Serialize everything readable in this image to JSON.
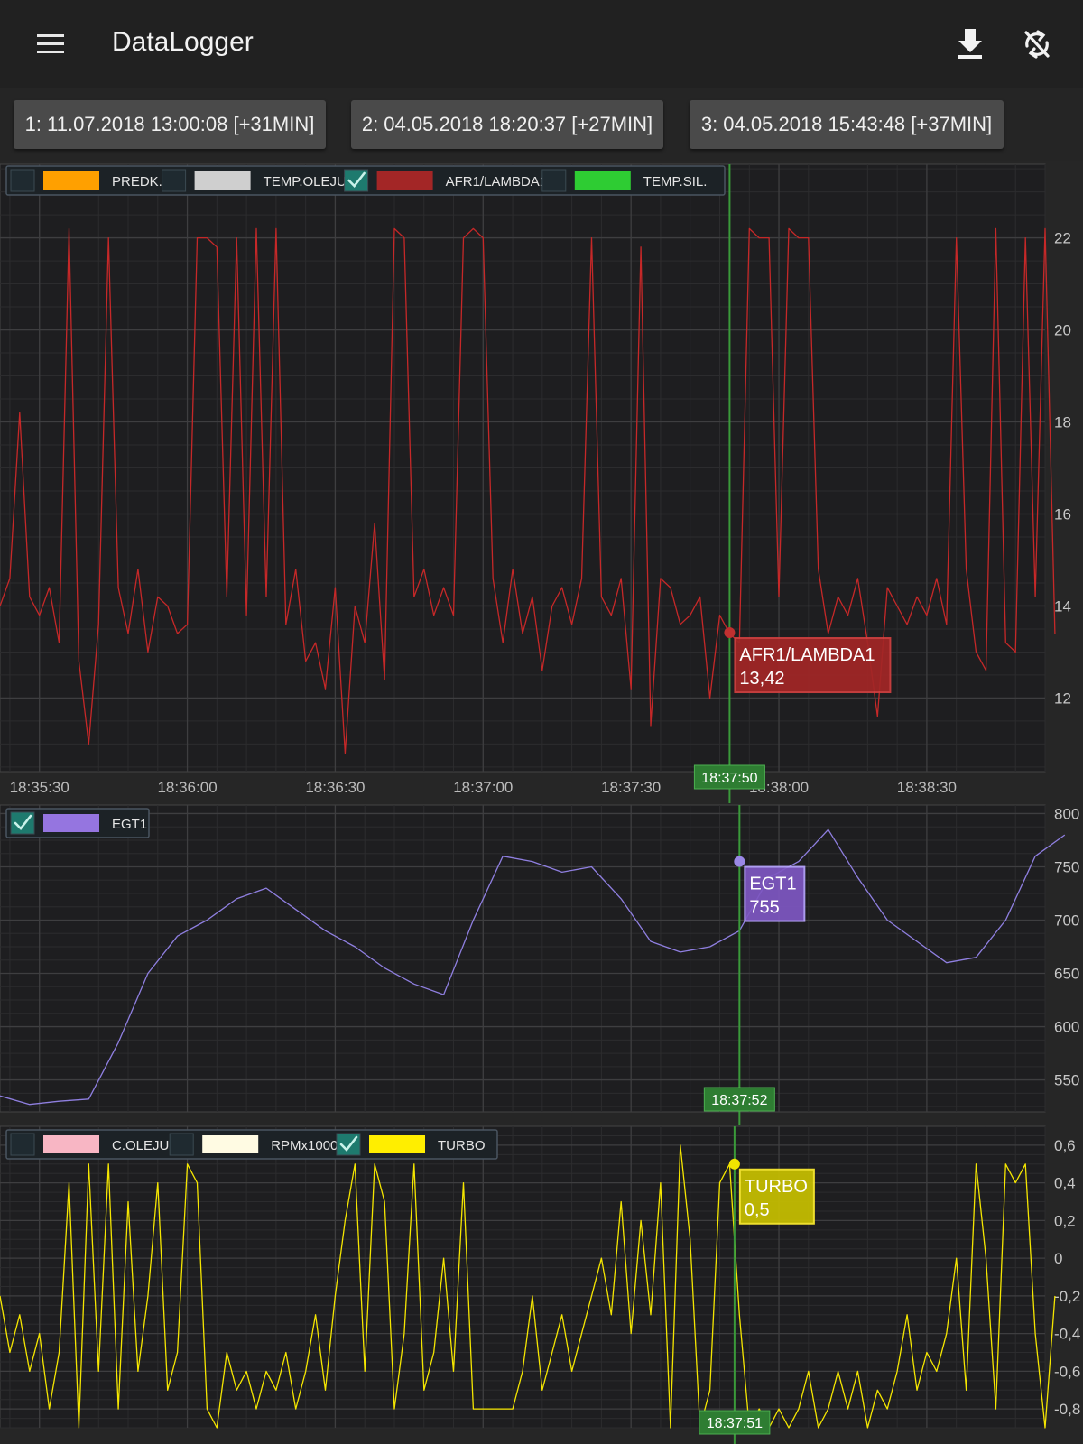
{
  "app": {
    "title": "DataLogger",
    "icons": [
      "menu-icon",
      "download-icon",
      "sync-disabled-icon"
    ]
  },
  "sessions": [
    {
      "label": "1: 11.07.2018 13:00:08 [+31MIN]"
    },
    {
      "label": "2: 04.05.2018 18:20:37 [+27MIN]"
    },
    {
      "label": "3: 04.05.2018 15:43:48 [+37MIN]"
    }
  ],
  "colors": {
    "grid": "#3a3a3a",
    "cursor": "#3a9a3a",
    "cursor_label": "#2e7d32"
  },
  "chart_data": [
    {
      "type": "line",
      "x": [
        "18:35:22",
        "18:35:24",
        "18:35:26",
        "18:35:28",
        "18:35:30",
        "18:35:32",
        "18:35:34",
        "18:35:36",
        "18:35:38",
        "18:35:40",
        "18:35:42",
        "18:35:44",
        "18:35:46",
        "18:35:48",
        "18:35:50",
        "18:35:52",
        "18:35:54",
        "18:35:56",
        "18:35:58",
        "18:36:00",
        "18:36:02",
        "18:36:04",
        "18:36:06",
        "18:36:08",
        "18:36:10",
        "18:36:12",
        "18:36:14",
        "18:36:16",
        "18:36:18",
        "18:36:20",
        "18:36:22",
        "18:36:24",
        "18:36:26",
        "18:36:28",
        "18:36:30",
        "18:36:32",
        "18:36:34",
        "18:36:36",
        "18:36:38",
        "18:36:40",
        "18:36:42",
        "18:36:44",
        "18:36:46",
        "18:36:48",
        "18:36:50",
        "18:36:52",
        "18:36:54",
        "18:36:56",
        "18:36:58",
        "18:37:00",
        "18:37:02",
        "18:37:04",
        "18:37:06",
        "18:37:08",
        "18:37:10",
        "18:37:12",
        "18:37:14",
        "18:37:16",
        "18:37:18",
        "18:37:20",
        "18:37:22",
        "18:37:24",
        "18:37:26",
        "18:37:28",
        "18:37:30",
        "18:37:32",
        "18:37:34",
        "18:37:36",
        "18:37:38",
        "18:37:40",
        "18:37:42",
        "18:37:44",
        "18:37:46",
        "18:37:48",
        "18:37:50",
        "18:37:52",
        "18:37:54",
        "18:37:56",
        "18:37:58",
        "18:38:00",
        "18:38:02",
        "18:38:04",
        "18:38:06",
        "18:38:08",
        "18:38:10",
        "18:38:12",
        "18:38:14",
        "18:38:16",
        "18:38:18",
        "18:38:20",
        "18:38:22",
        "18:38:24",
        "18:38:26",
        "18:38:28",
        "18:38:30",
        "18:38:32",
        "18:38:34",
        "18:38:36",
        "18:38:38",
        "18:38:40",
        "18:38:42",
        "18:38:44",
        "18:38:46",
        "18:38:48",
        "18:38:50",
        "18:38:52",
        "18:38:54",
        "18:38:56"
      ],
      "series": [
        {
          "name": "AFR1/LAMBDA1",
          "color": "#c62828",
          "values": [
            14.0,
            14.6,
            18.2,
            14.2,
            13.8,
            14.4,
            13.2,
            22.2,
            12.8,
            11.0,
            13.6,
            22.0,
            14.4,
            13.4,
            14.8,
            13.0,
            14.2,
            14.0,
            13.4,
            13.6,
            22.0,
            22.0,
            21.8,
            14.2,
            22.0,
            13.8,
            22.2,
            14.2,
            22.2,
            13.6,
            14.8,
            12.8,
            13.2,
            12.2,
            14.4,
            10.8,
            14.0,
            13.2,
            15.8,
            12.4,
            22.2,
            22.0,
            14.2,
            14.8,
            13.8,
            14.4,
            13.8,
            22.0,
            22.2,
            22.0,
            14.6,
            13.2,
            14.8,
            13.4,
            14.2,
            12.6,
            14.0,
            14.4,
            13.6,
            14.6,
            22.0,
            14.2,
            13.8,
            14.6,
            12.2,
            21.8,
            11.4,
            14.6,
            14.4,
            13.6,
            13.8,
            14.2,
            12.0,
            13.8,
            13.4,
            13.2,
            22.2,
            22.0,
            22.0,
            14.2,
            22.2,
            22.0,
            22.0,
            14.8,
            13.4,
            14.2,
            13.8,
            14.6,
            13.2,
            11.6,
            14.4,
            14.0,
            13.6,
            14.2,
            13.8,
            14.6,
            13.6,
            22.0,
            14.8,
            13.0,
            12.6,
            22.2,
            13.2,
            13.0,
            22.0,
            14.2,
            22.2,
            13.4
          ]
        }
      ],
      "ylim": [
        10.4,
        23.6
      ],
      "yticks": [
        "12",
        "14",
        "16",
        "18",
        "20",
        "22"
      ],
      "xticks": [
        "18:35:30",
        "18:36:00",
        "18:36:30",
        "18:37:00",
        "18:37:30",
        "18:38:00",
        "18:38:30"
      ],
      "legend": [
        {
          "name": "PREDK.",
          "color": "#ffa000",
          "checked": false
        },
        {
          "name": "TEMP.OLEJU",
          "color": "#cfcfcf",
          "checked": false
        },
        {
          "name": "AFR1/LAMBDA1",
          "color": "#a32626",
          "checked": true
        },
        {
          "name": "TEMP.SIL.",
          "color": "#2ecc33",
          "checked": false
        }
      ],
      "cursor_time": "18:37:50",
      "tooltip": {
        "name": "AFR1/LAMBDA1",
        "value": "13,42",
        "color": "#a32626"
      }
    },
    {
      "type": "line",
      "x": [
        "18:35:22",
        "18:35:28",
        "18:35:34",
        "18:35:40",
        "18:35:46",
        "18:35:52",
        "18:35:58",
        "18:36:04",
        "18:36:10",
        "18:36:16",
        "18:36:22",
        "18:36:28",
        "18:36:34",
        "18:36:40",
        "18:36:46",
        "18:36:52",
        "18:36:58",
        "18:37:04",
        "18:37:10",
        "18:37:16",
        "18:37:22",
        "18:37:28",
        "18:37:34",
        "18:37:40",
        "18:37:46",
        "18:37:52",
        "18:37:58",
        "18:38:04",
        "18:38:10",
        "18:38:16",
        "18:38:22",
        "18:38:28",
        "18:38:34",
        "18:38:40",
        "18:38:46",
        "18:38:52",
        "18:38:58"
      ],
      "series": [
        {
          "name": "EGT1",
          "color": "#8f7fe0",
          "values": [
            535,
            527,
            530,
            532,
            585,
            650,
            685,
            700,
            720,
            730,
            710,
            690,
            675,
            655,
            640,
            630,
            700,
            760,
            755,
            745,
            750,
            720,
            680,
            670,
            675,
            690,
            740,
            755,
            785,
            740,
            700,
            680,
            660,
            665,
            700,
            760,
            780
          ]
        }
      ],
      "ylim": [
        520,
        808
      ],
      "yticks": [
        "550",
        "600",
        "650",
        "700",
        "750",
        "800"
      ],
      "legend": [
        {
          "name": "EGT1",
          "color": "#9575e0",
          "checked": true
        }
      ],
      "cursor_time": "18:37:52",
      "tooltip": {
        "name": "EGT1",
        "value": "755",
        "color": "#7e57c2"
      }
    },
    {
      "type": "line",
      "x": [
        "18:35:22",
        "18:35:24",
        "18:35:26",
        "18:35:28",
        "18:35:30",
        "18:35:32",
        "18:35:34",
        "18:35:36",
        "18:35:38",
        "18:35:40",
        "18:35:42",
        "18:35:44",
        "18:35:46",
        "18:35:48",
        "18:35:50",
        "18:35:52",
        "18:35:54",
        "18:35:56",
        "18:35:58",
        "18:36:00",
        "18:36:02",
        "18:36:04",
        "18:36:06",
        "18:36:08",
        "18:36:10",
        "18:36:12",
        "18:36:14",
        "18:36:16",
        "18:36:18",
        "18:36:20",
        "18:36:22",
        "18:36:24",
        "18:36:26",
        "18:36:28",
        "18:36:30",
        "18:36:32",
        "18:36:34",
        "18:36:36",
        "18:36:38",
        "18:36:40",
        "18:36:42",
        "18:36:44",
        "18:36:46",
        "18:36:48",
        "18:36:50",
        "18:36:52",
        "18:36:54",
        "18:36:56",
        "18:36:58",
        "18:37:00",
        "18:37:02",
        "18:37:04",
        "18:37:06",
        "18:37:08",
        "18:37:10",
        "18:37:12",
        "18:37:14",
        "18:37:16",
        "18:37:18",
        "18:37:20",
        "18:37:22",
        "18:37:24",
        "18:37:26",
        "18:37:28",
        "18:37:30",
        "18:37:32",
        "18:37:34",
        "18:37:36",
        "18:37:38",
        "18:37:40",
        "18:37:42",
        "18:37:44",
        "18:37:46",
        "18:37:48",
        "18:37:50",
        "18:37:52",
        "18:37:54",
        "18:37:56",
        "18:37:58",
        "18:38:00",
        "18:38:02",
        "18:38:04",
        "18:38:06",
        "18:38:08",
        "18:38:10",
        "18:38:12",
        "18:38:14",
        "18:38:16",
        "18:38:18",
        "18:38:20",
        "18:38:22",
        "18:38:24",
        "18:38:26",
        "18:38:28",
        "18:38:30",
        "18:38:32",
        "18:38:34",
        "18:38:36",
        "18:38:38",
        "18:38:40",
        "18:38:42",
        "18:38:44",
        "18:38:46",
        "18:38:48",
        "18:38:50",
        "18:38:52",
        "18:38:54",
        "18:38:56"
      ],
      "series": [
        {
          "name": "TURBO",
          "color": "#f5e600",
          "values": [
            -0.2,
            -0.5,
            -0.3,
            -0.6,
            -0.4,
            -0.8,
            -0.5,
            0.4,
            -0.9,
            0.5,
            -0.6,
            0.5,
            -0.8,
            0.3,
            -0.6,
            -0.2,
            0.4,
            -0.7,
            -0.5,
            0.5,
            0.4,
            -0.8,
            -0.9,
            -0.5,
            -0.7,
            -0.6,
            -0.8,
            -0.6,
            -0.7,
            -0.5,
            -0.8,
            -0.6,
            -0.3,
            -0.7,
            -0.2,
            0.2,
            0.5,
            -0.6,
            0.5,
            0.3,
            -0.8,
            -0.4,
            0.5,
            -0.7,
            -0.5,
            0.0,
            -0.6,
            0.4,
            -0.8,
            -0.8,
            -0.8,
            -0.8,
            -0.8,
            -0.6,
            -0.2,
            -0.7,
            -0.5,
            -0.3,
            -0.6,
            -0.4,
            -0.2,
            0.0,
            -0.3,
            0.3,
            -0.4,
            0.2,
            -0.3,
            0.4,
            -0.9,
            0.6,
            0.1,
            -0.9,
            -0.7,
            0.4,
            0.5,
            -0.3,
            -0.9,
            -0.8,
            -0.9,
            -0.8,
            -0.9,
            -0.8,
            -0.6,
            -0.9,
            -0.8,
            -0.6,
            -0.8,
            -0.6,
            -0.9,
            -0.7,
            -0.8,
            -0.6,
            -0.3,
            -0.7,
            -0.5,
            -0.6,
            -0.4,
            0.0,
            -0.7,
            0.5,
            0.0,
            -0.8,
            0.5,
            0.4,
            0.5,
            -0.4,
            -0.9,
            -0.2
          ]
        }
      ],
      "ylim": [
        -0.9,
        0.7
      ],
      "yticks": [
        "-0,8",
        "-0,6",
        "-0,4",
        "-0,2",
        "0",
        "0,2",
        "0,4",
        "0,6"
      ],
      "legend": [
        {
          "name": "C.OLEJU",
          "color": "#f8b6c4",
          "checked": false
        },
        {
          "name": "RPMx1000",
          "color": "#fffbe3",
          "checked": false
        },
        {
          "name": "TURBO",
          "color": "#ffee00",
          "checked": true
        }
      ],
      "cursor_time": "18:37:51",
      "tooltip": {
        "name": "TURBO",
        "value": "0,5",
        "color": "#c8c000"
      }
    }
  ]
}
